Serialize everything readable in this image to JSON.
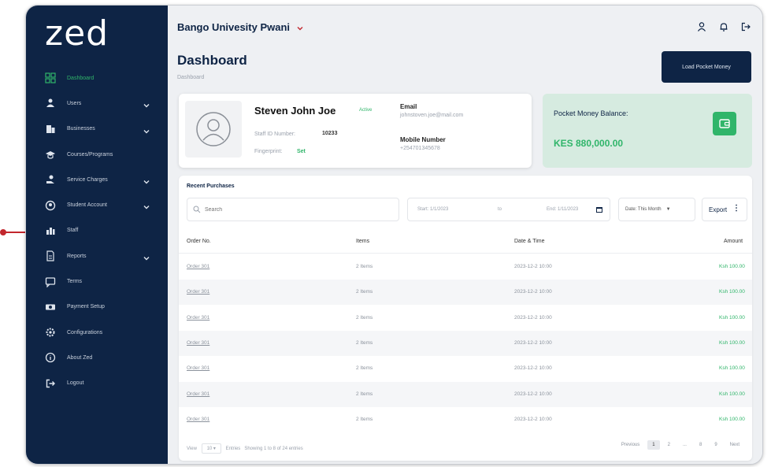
{
  "logo": "zed",
  "sidebar": {
    "items": [
      {
        "label": "Dashboard",
        "icon": "dashboard-icon",
        "active": true,
        "chevron": false
      },
      {
        "label": "Users",
        "icon": "users-icon",
        "active": false,
        "chevron": true
      },
      {
        "label": "Businesses",
        "icon": "building-icon",
        "active": false,
        "chevron": true
      },
      {
        "label": "Courses/Programs",
        "icon": "graduation-cap-icon",
        "active": false,
        "chevron": false
      },
      {
        "label": "Service Charges",
        "icon": "hand-coins-icon",
        "active": false,
        "chevron": true
      },
      {
        "label": "Student Account",
        "icon": "account-icon",
        "active": false,
        "chevron": true
      },
      {
        "label": "Staff",
        "icon": "staff-icon",
        "active": false,
        "chevron": false
      },
      {
        "label": "Reports",
        "icon": "report-icon",
        "active": false,
        "chevron": true
      },
      {
        "label": "Terms",
        "icon": "message-square-icon",
        "active": false,
        "chevron": false
      },
      {
        "label": "Payment Setup",
        "icon": "cash-icon",
        "active": false,
        "chevron": false
      },
      {
        "label": "Configurations",
        "icon": "gear-icon",
        "active": false,
        "chevron": false
      },
      {
        "label": "About Zed",
        "icon": "info-icon",
        "active": false,
        "chevron": false
      },
      {
        "label": "Logout",
        "icon": "logout-icon",
        "active": false,
        "chevron": false
      }
    ]
  },
  "header": {
    "school": "Bango Univesity Pwani",
    "page_title": "Dashboard",
    "breadcrumb": "Dashboard",
    "load_button": "Load Pocket Money"
  },
  "profile": {
    "name": "Steven John Joe",
    "status": "Active",
    "staff_id_label": "Staff ID Number:",
    "staff_id": "10233",
    "fingerprint_label": "Fingerprint:",
    "fingerprint": "Set",
    "email_label": "Email",
    "email": "johnstoven.joe@mail.com",
    "mobile_label": "Mobile Number",
    "mobile": "+254701345678"
  },
  "pocket": {
    "label": "Pocket Money Balance:",
    "amount": "KES 880,000.00"
  },
  "purchases": {
    "title": "Recent Purchases",
    "search_placeholder": "Search",
    "start_date": "Start: 1/1/2023",
    "to_label": "to",
    "end_date": "End: 1/11/2023",
    "date_filter": "Date: This Month",
    "export_label": "Export",
    "columns": [
      "Order No.",
      "Items",
      "Date & Time",
      "Amount"
    ],
    "rows": [
      {
        "order": "Order 301",
        "items": "2 Items",
        "datetime": "2023-12-2 10:00",
        "amount": "Ksh 100.00"
      },
      {
        "order": "Order 301",
        "items": "2 Items",
        "datetime": "2023-12-2 10:00",
        "amount": "Ksh 100.00"
      },
      {
        "order": "Order 301",
        "items": "2 Items",
        "datetime": "2023-12-2 10:00",
        "amount": "Ksh 100.00"
      },
      {
        "order": "Order 301",
        "items": "2 Items",
        "datetime": "2023-12-2 10:00",
        "amount": "Ksh 100.00"
      },
      {
        "order": "Order 301",
        "items": "2 Items",
        "datetime": "2023-12-2 10:00",
        "amount": "Ksh 100.00"
      },
      {
        "order": "Order 301",
        "items": "2 Items",
        "datetime": "2023-12-2 10:00",
        "amount": "Ksh 100.00"
      },
      {
        "order": "Order 301",
        "items": "2 Items",
        "datetime": "2023-12-2 10:00",
        "amount": "Ksh 100.00"
      }
    ],
    "footer_view": "View",
    "footer_count": "10",
    "footer_entries": "Entries",
    "footer_showing": "Showing 1 to 8 of 24 entries",
    "pager": {
      "prev": "Previous",
      "pages": [
        "1",
        "2",
        "...",
        "8",
        "9"
      ],
      "next": "Next"
    }
  },
  "colors": {
    "sidebar": "#0e2445",
    "accent": "#30b56a",
    "pocket_bg": "#d6ebe0",
    "marker": "#c2272d"
  }
}
